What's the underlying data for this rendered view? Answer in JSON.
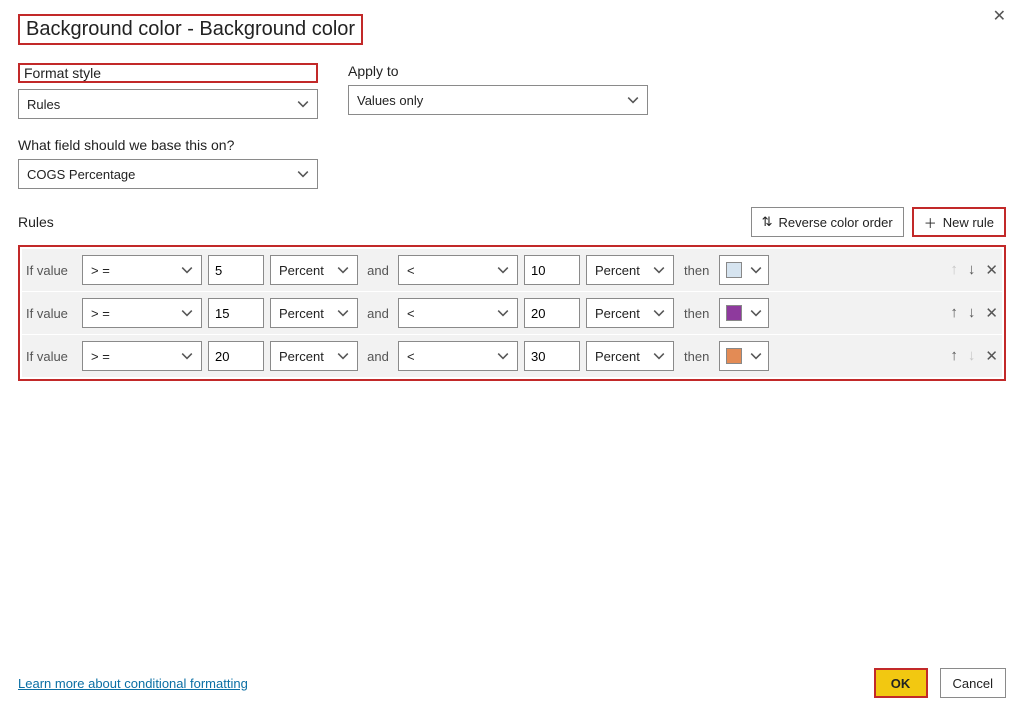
{
  "title": "Background color - Background color",
  "labels": {
    "formatStyle": "Format style",
    "applyTo": "Apply to",
    "whatField": "What field should we base this on?",
    "rules": "Rules",
    "reverse": "Reverse color order",
    "newRule": "New rule",
    "ifValue": "If value",
    "and": "and",
    "then": "then",
    "learnMore": "Learn more about conditional formatting",
    "ok": "OK",
    "cancel": "Cancel"
  },
  "selects": {
    "formatStyle": "Rules",
    "applyTo": "Values only",
    "field": "COGS Percentage"
  },
  "rules": [
    {
      "op1": "> =",
      "val1": "5",
      "unit1": "Percent",
      "op2": "<",
      "val2": "10",
      "unit2": "Percent",
      "color": "#d6e4f0",
      "upDisabled": true,
      "downDisabled": false
    },
    {
      "op1": "> =",
      "val1": "15",
      "unit1": "Percent",
      "op2": "<",
      "val2": "20",
      "unit2": "Percent",
      "color": "#8e3a9d",
      "upDisabled": false,
      "downDisabled": false
    },
    {
      "op1": "> =",
      "val1": "20",
      "unit1": "Percent",
      "op2": "<",
      "val2": "30",
      "unit2": "Percent",
      "color": "#e38b55",
      "upDisabled": false,
      "downDisabled": true
    }
  ]
}
